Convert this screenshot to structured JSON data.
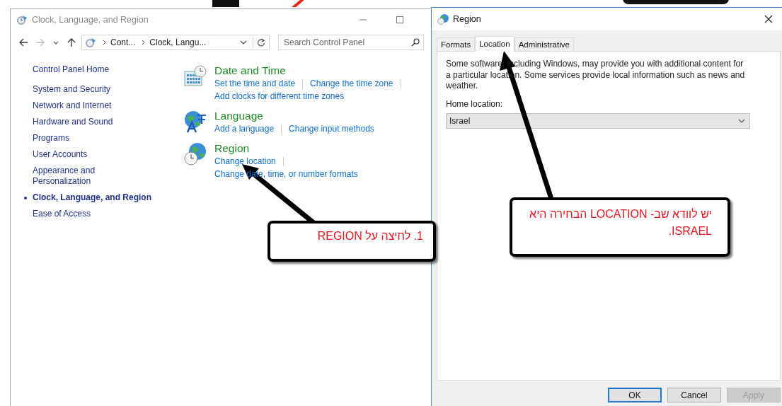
{
  "control_panel": {
    "title": "Clock, Language, and Region",
    "breadcrumb": [
      "Cont...",
      "Clock, Langu..."
    ],
    "search": {
      "placeholder": "Search Control Panel"
    },
    "home_link": "Control Panel Home",
    "sidebar": {
      "items": [
        {
          "label": "System and Security",
          "selected": false
        },
        {
          "label": "Network and Internet",
          "selected": false
        },
        {
          "label": "Hardware and Sound",
          "selected": false
        },
        {
          "label": "Programs",
          "selected": false
        },
        {
          "label": "User Accounts",
          "selected": false
        },
        {
          "label": "Appearance and Personalization",
          "selected": false
        },
        {
          "label": "Clock, Language, and Region",
          "selected": true
        },
        {
          "label": "Ease of Access",
          "selected": false
        }
      ]
    },
    "categories": [
      {
        "kind": "clock",
        "title": "Date and Time",
        "link_lines": [
          [
            "Set the time and date",
            "Change the time zone"
          ],
          [
            "Add clocks for different time zones"
          ]
        ]
      },
      {
        "kind": "language",
        "title": "Language",
        "link_lines": [
          [
            "Add a language",
            "Change input methods"
          ]
        ]
      },
      {
        "kind": "region",
        "title": "Region",
        "link_lines": [
          [
            "Change location"
          ],
          [
            "Change date, time, or number formats"
          ]
        ]
      }
    ]
  },
  "region_dialog": {
    "title": "Region",
    "tabs": [
      {
        "label": "Formats",
        "selected": false
      },
      {
        "label": "Location",
        "selected": true
      },
      {
        "label": "Administrative",
        "selected": false
      }
    ],
    "description": "Some software, including Windows, may provide you with additional content for a particular location. Some services provide local information such as news and weather.",
    "home_location_label": "Home location:",
    "home_location": "Israel",
    "buttons": [
      {
        "label": "OK",
        "kind": "default",
        "disabled": false
      },
      {
        "label": "Cancel",
        "kind": "normal",
        "disabled": false
      },
      {
        "label": "Apply",
        "kind": "normal",
        "disabled": true
      }
    ]
  },
  "callouts": [
    {
      "text": "1. לחיצה על REGION"
    },
    {
      "text": "יש לוודא שב- LOCATION הבחירה היא ISRAEL."
    }
  ]
}
